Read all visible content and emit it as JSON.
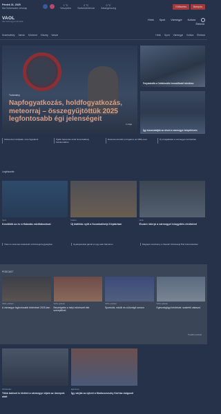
{
  "topbar": {
    "date": "Péntek 31. 2025",
    "nameday": "Ma Szilveszter névnap",
    "weather": [
      {
        "label": "Veszprém",
        "value": "1 °C"
      },
      {
        "label": "Székesfehérvár",
        "value": "2 °C"
      },
      {
        "label": "Zalaegerszeg",
        "value": "0 °C"
      }
    ],
    "subscribe_button": "Előfizetés",
    "login_button": "Belépés"
  },
  "header": {
    "logo": "VAOL",
    "logo_sub": "Vas Vármegyei Hírportál",
    "nav": [
      "Hírek",
      "Sport",
      "Vármegye",
      "Kultúra",
      "Életmód"
    ]
  },
  "subnav": {
    "left": [
      "Szombathely",
      "Sárvár",
      "Körmend",
      "Kőszeg",
      "Vasvár"
    ],
    "right": [
      "Hírek",
      "Sport",
      "Vármegye",
      "Kultúra",
      "Életmód"
    ]
  },
  "hero": {
    "tag": "Tudomány",
    "title": "Napfogyatkozás, holdfogyatkozás, meteorraj – összegyűjtöttük 2025 legfontosabb égi jelenségeit",
    "time": "2 órája"
  },
  "side_articles": [
    {
      "title": "Folytatódik a Celldömölki termálfürdő bővítése"
    },
    {
      "title": "Így búcsúztatják az óévet a vármegye településein"
    }
  ],
  "links_row_1": [
    "Szilveszteri tűzijáték: mire figyeljünk",
    "Újabb fejlesztés indul Szombathely belvárosában",
    "Rekordot döntött a forgalom az M86-oson",
    "Új szolgáltatás a vármegyei kórházban"
  ],
  "section_label": "Legfrissebb",
  "cards": [
    {
      "cat": "Sport",
      "title": "Kezdődik az év a Haladás edzőtáborával"
    },
    {
      "cat": "Kultúra",
      "title": "Új kiállítás nyílt a Szombathelyi Képtárban"
    },
    {
      "cat": "Hírek",
      "title": "Évzáró interjú a vármegyei közgyűlés elnökével"
    }
  ],
  "links_row_2": [
    "Télen is érdemes kirándulni a Kőszegi-hegységben",
    "Gyalogosokat gázolt el egy autó Sárváron",
    "Meglepő eredmény a Vasvári Közösségi Ház felmérésében"
  ],
  "podcast": {
    "label": "PODCAST",
    "items": [
      {
        "meta": "VAOL podcast",
        "title": "A vármegye legfontosabb történései 2025-ben"
      },
      {
        "meta": "VAOL podcast",
        "title": "Beszélgetés a helyi művészeti élet szereplőivel"
      },
      {
        "meta": "VAOL podcast",
        "title": "Sportolók, edzők és a közelgő szezon"
      },
      {
        "meta": "VAOL podcast",
        "title": "Egészségügyi kérdések: szakértő válaszol"
      }
    ],
    "more": "További podcast"
  },
  "bottom_cards": [
    {
      "cat": "Közlekedés",
      "title": "Több baleset is történt a vármegye útjain az ünnepek alatt"
    },
    {
      "cat": "Egészség",
      "title": "Így várják az újévet a Markusovszky Kórház dolgozói"
    }
  ]
}
